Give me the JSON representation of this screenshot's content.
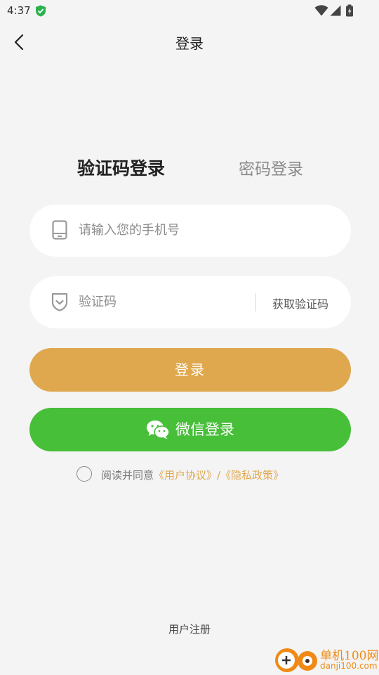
{
  "status_bar": {
    "time": "4:37",
    "icons": [
      "shield-status-icon",
      "wifi-icon",
      "signal-icon",
      "battery-icon"
    ]
  },
  "header": {
    "title": "登录",
    "back_icon": "chevron-left-icon"
  },
  "tabs": [
    {
      "label": "验证码登录",
      "active": true
    },
    {
      "label": "密码登录",
      "active": false
    }
  ],
  "phone_field": {
    "placeholder": "请输入您的手机号",
    "value": "",
    "icon": "phone-icon"
  },
  "code_field": {
    "placeholder": "验证码",
    "value": "",
    "icon": "shield-icon",
    "get_code_label": "获取验证码"
  },
  "login_button": {
    "label": "登录"
  },
  "wechat_button": {
    "label": "微信登录",
    "icon": "wechat-icon"
  },
  "agreement": {
    "prefix": "阅读并同意",
    "user_agreement": "《用户协议》",
    "separator": "/",
    "privacy_policy": "《隐私政策》",
    "checked": false
  },
  "register_link": "用户注册",
  "watermark": {
    "name": "单机100网",
    "url": "danji100.com"
  },
  "colors": {
    "background": "#f4f4f4",
    "primary_orange": "#e0a84e",
    "wechat_green": "#47bf39",
    "active_tab": "#222222",
    "inactive_tab": "#8a8a8a"
  }
}
